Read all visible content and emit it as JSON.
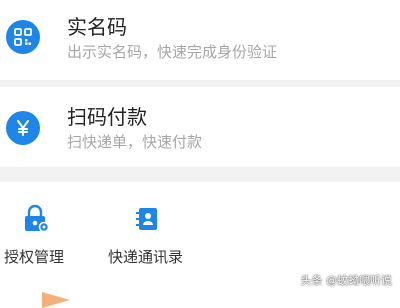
{
  "colors": {
    "accent": "#1e86e8",
    "title_text": "#222222",
    "subtitle_text": "#a6a6a6",
    "separator": "#f2f2f2"
  },
  "verify_item": {
    "icon": "qr-code-icon",
    "title": "实名码",
    "subtitle": "出示实名码，快速完成身份验证"
  },
  "pay_item": {
    "icon": "yen-icon",
    "title": "扫码付款",
    "subtitle": "扫快递单，快速付款",
    "icon_glyph": "¥"
  },
  "shortcuts": [
    {
      "icon": "lock-gear-icon",
      "label": "授权管理"
    },
    {
      "icon": "contact-book-icon",
      "label": "快递通讯录"
    }
  ],
  "watermark": "头条 @蚊蚴喂听说"
}
